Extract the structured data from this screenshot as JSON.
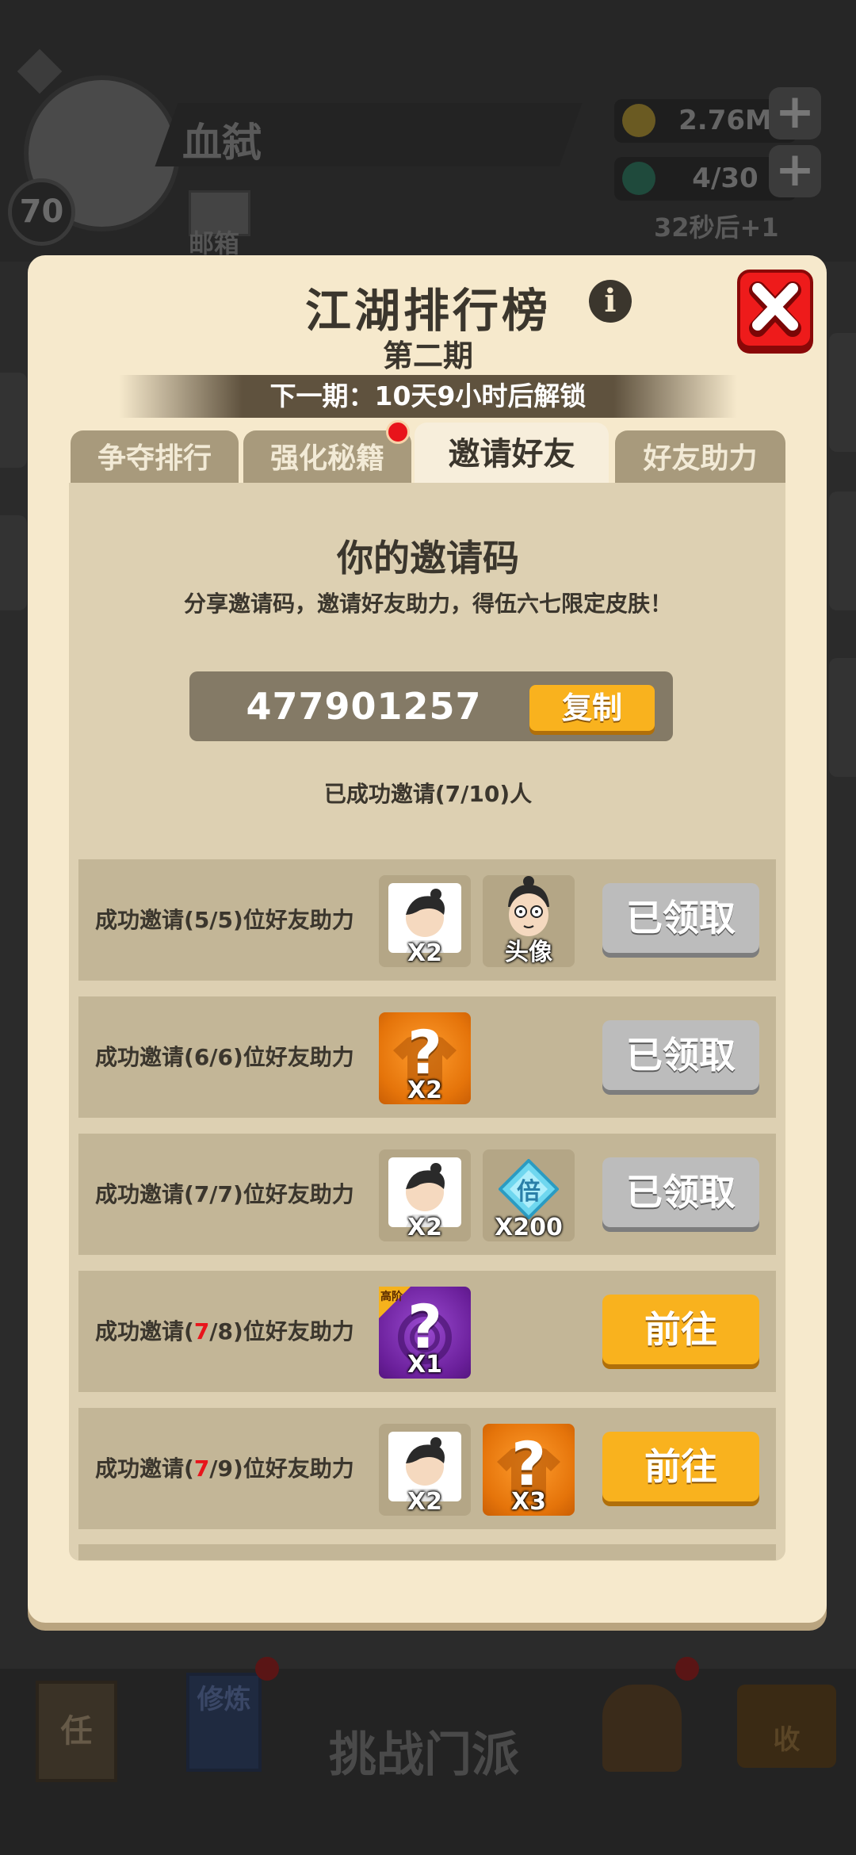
{
  "background": {
    "player_name": "血弑",
    "level": "70",
    "mail_label": "邮箱",
    "coins": "2.76M",
    "energy": "4/30",
    "energy_timer": "32秒后+1",
    "bottom_nav": {
      "task_label": "任",
      "cultivate_label": "修炼",
      "challenge_label": "挑战门派",
      "collect_label": "收"
    }
  },
  "modal": {
    "title": "江湖排行榜",
    "subtitle": "第二期",
    "unlock_text": "下一期：10天9小时后解锁",
    "tabs": [
      {
        "label": "争夺排行",
        "active": false
      },
      {
        "label": "强化秘籍",
        "active": false,
        "has_dot": true
      },
      {
        "label": "邀请好友",
        "active": true
      },
      {
        "label": "好友助力",
        "active": false
      }
    ],
    "invite": {
      "title": "你的邀请码",
      "description": "分享邀请码，邀请好友助力，得伍六七限定皮肤！",
      "code": "477901257",
      "copy_label": "复制",
      "invited_count": "已成功邀请(7/10)人"
    },
    "rewards": [
      {
        "label_pre": "成功邀请(",
        "label_num": "5",
        "label_post": "/5)位好友助力",
        "items": [
          {
            "type": "puzzle-portrait",
            "qty": "X2"
          },
          {
            "type": "avatar-frame",
            "qty": "头像"
          }
        ],
        "button": "已领取",
        "status": "claimed"
      },
      {
        "label_pre": "成功邀请(",
        "label_num": "6",
        "label_post": "/6)位好友助力",
        "items": [
          {
            "type": "mystery-shirt-orange",
            "qty": "X2"
          }
        ],
        "button": "已领取",
        "status": "claimed"
      },
      {
        "label_pre": "成功邀请(",
        "label_num": "7",
        "label_post": "/7)位好友助力",
        "items": [
          {
            "type": "puzzle-portrait",
            "qty": "X2"
          },
          {
            "type": "multiplier-gem",
            "qty": "X200",
            "gem_text": "倍"
          }
        ],
        "button": "已领取",
        "status": "claimed"
      },
      {
        "label_pre": "成功邀请(",
        "label_num": "7",
        "label_post": "/8)位好友助力",
        "items": [
          {
            "type": "mystery-purple",
            "qty": "X1",
            "badge": "高阶"
          }
        ],
        "button": "前往",
        "status": "go"
      },
      {
        "label_pre": "成功邀请(",
        "label_num": "7",
        "label_post": "/9)位好友助力",
        "items": [
          {
            "type": "puzzle-portrait",
            "qty": "X2"
          },
          {
            "type": "mystery-shirt-orange",
            "qty": "X3"
          }
        ],
        "button": "前往",
        "status": "go"
      }
    ]
  },
  "colors": {
    "panel": "#f6e9cc",
    "content": "#ddd0b2",
    "row": "#c3b697",
    "accent_orange": "#f9b21e",
    "claimed_gray": "#bcbcbc",
    "close_red": "#ee1b1b",
    "progress_red": "#e8141b"
  }
}
